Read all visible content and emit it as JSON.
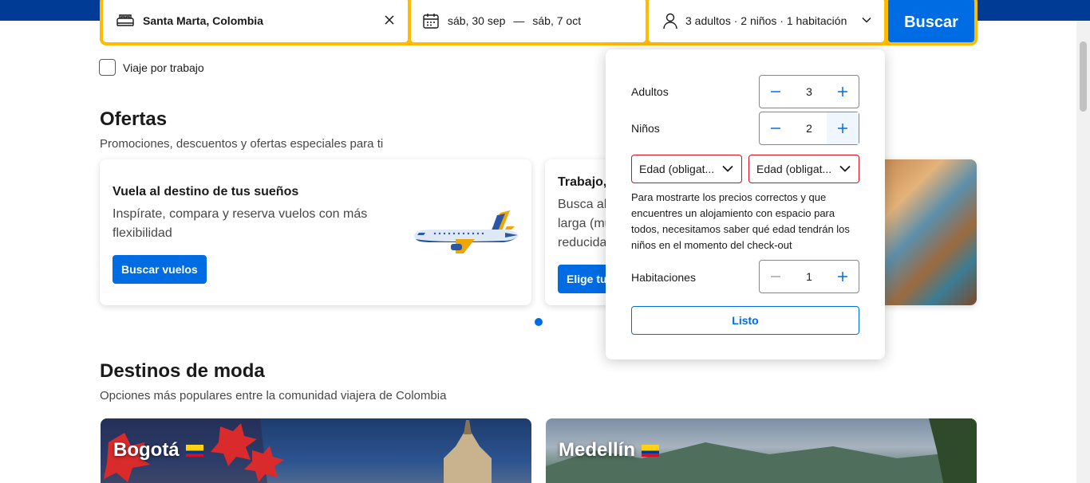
{
  "search": {
    "destination": "Santa Marta, Colombia",
    "date_start": "sáb, 30 sep",
    "date_sep": "—",
    "date_end": "sáb, 7 oct",
    "occupancy": "3 adultos · 2 niños · 1 habitación",
    "search_button": "Buscar"
  },
  "work_trip": {
    "label": "Viaje por trabajo",
    "checked": false
  },
  "offers": {
    "title": "Ofertas",
    "subtitle": "Promociones, descuentos y ofertas especiales para ti",
    "cards": [
      {
        "title": "Vuela al destino de tus sueños",
        "desc_line1": "Inspírate, compara y reserva vuelos con más",
        "desc_line2": "flexibilidad",
        "button": "Buscar vuelos"
      },
      {
        "title": "Trabajo,",
        "desc_line1": "Busca alo",
        "desc_line2": "larga (mu",
        "desc_line3": "reducida",
        "button": "Elige tu"
      }
    ]
  },
  "trending": {
    "title": "Destinos de moda",
    "subtitle": "Opciones más populares entre la comunidad viajera de Colombia",
    "destinations": [
      {
        "name": "Bogotá"
      },
      {
        "name": "Medellín"
      }
    ]
  },
  "occupancy_popup": {
    "adults_label": "Adultos",
    "adults_value": "3",
    "children_label": "Niños",
    "children_value": "2",
    "age_placeholder_1": "Edad (obligat...",
    "age_placeholder_2": "Edad (obligat...",
    "note": "Para mostrarte los precios correctos y que encuentres un alojamiento con espacio para todos, necesitamos saber qué edad tendrán los niños en el momento del check-out",
    "rooms_label": "Habitaciones",
    "rooms_value": "1",
    "done_button": "Listo"
  },
  "colors": {
    "brand_blue": "#003b95",
    "action_blue": "#006ce4",
    "search_yellow": "#febb02",
    "error_red": "#d4111e"
  }
}
